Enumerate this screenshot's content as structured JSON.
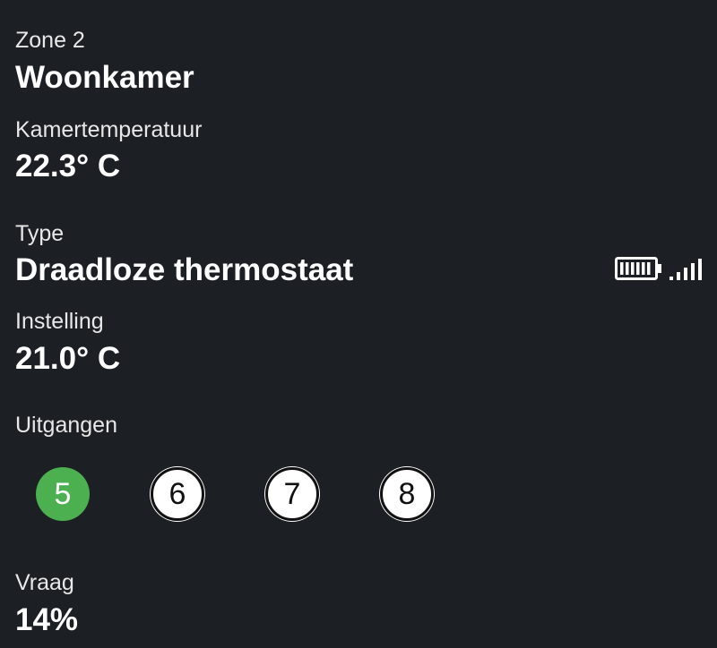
{
  "zone": {
    "label": "Zone 2",
    "name": "Woonkamer"
  },
  "room_temperature": {
    "label": "Kamertemperatuur",
    "value": "22.3° C"
  },
  "type": {
    "label": "Type",
    "value": "Draadloze thermostaat",
    "battery_icon": "battery-full-icon",
    "signal_icon": "signal-strength-icon"
  },
  "setting": {
    "label": "Instelling",
    "value": "21.0° C"
  },
  "outputs": {
    "label": "Uitgangen",
    "items": [
      {
        "number": "5",
        "active": true
      },
      {
        "number": "6",
        "active": false
      },
      {
        "number": "7",
        "active": false
      },
      {
        "number": "8",
        "active": false
      }
    ],
    "active_color": "#4caf50"
  },
  "demand": {
    "label": "Vraag",
    "value": "14%"
  },
  "colors": {
    "background": "#1c1f24",
    "text": "#ffffff",
    "active": "#4caf50"
  }
}
